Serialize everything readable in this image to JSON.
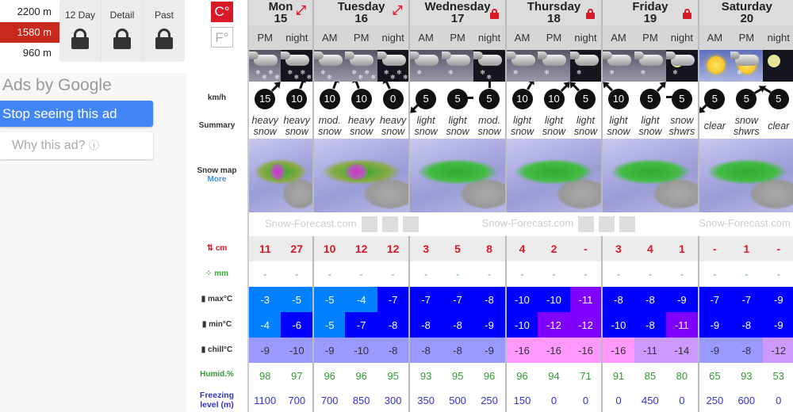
{
  "elevations": [
    {
      "label": "2200 m",
      "selected": false
    },
    {
      "label": "1580 m",
      "selected": true
    },
    {
      "label": "960 m",
      "selected": false
    }
  ],
  "tabs": [
    {
      "label": "12 Day",
      "icon": "lock-icon"
    },
    {
      "label": "Detail",
      "icon": "lock-icon"
    },
    {
      "label": "Past",
      "icon": "lock-icon"
    }
  ],
  "ads": {
    "title": "Ads by Google",
    "stop": "Stop seeing this ad",
    "why": "Why this ad?",
    "why_icon": "ⓘ"
  },
  "units": {
    "c": "C°",
    "f": "F°",
    "selected": "C°"
  },
  "row_labels": {
    "wind": "km/h",
    "summary": "Summary",
    "snowmap": "Snow map",
    "more": "More",
    "snow": "cm",
    "rain": "mm",
    "max": "max°C",
    "min": "min°C",
    "chill": "chill°C",
    "humid": "Humid.%",
    "freezing": "Freezing level (m)"
  },
  "colors": {
    "accent": "#d9192a",
    "temp_light_blue": "#0080ff",
    "temp_blue": "#0000ff",
    "temp_purple": "#8000ff",
    "chill_lavender": "#9999ff",
    "chill_light_purple": "#cc99ff",
    "chill_pink": "#ff99ff"
  },
  "logo_text": "Snow-Forecast.com",
  "days": [
    {
      "name": "Mon",
      "date": "15",
      "badge": "expand-icon",
      "periods": [
        "PM",
        "night"
      ]
    },
    {
      "name": "Tuesday",
      "date": "16",
      "badge": "expand-icon",
      "periods": [
        "AM",
        "PM",
        "night"
      ]
    },
    {
      "name": "Wednesday",
      "date": "17",
      "badge": "lock-icon",
      "periods": [
        "AM",
        "PM",
        "night"
      ]
    },
    {
      "name": "Thursday",
      "date": "18",
      "badge": "lock-icon",
      "periods": [
        "AM",
        "PM",
        "night"
      ]
    },
    {
      "name": "Friday",
      "date": "19",
      "badge": "lock-icon",
      "periods": [
        "AM",
        "PM",
        "night"
      ]
    },
    {
      "name": "Saturday",
      "date": "20",
      "badge": "",
      "periods": [
        "AM",
        "PM",
        "night"
      ]
    }
  ],
  "columns": [
    {
      "icon": "heavy-snow-day",
      "wind": "15",
      "wind_dir": 45,
      "summary": "heavy snow",
      "snow": "11",
      "rain": "-",
      "max": "-3",
      "min": "-4",
      "chill": "-9",
      "humid": "98",
      "freezing": "1100"
    },
    {
      "icon": "heavy-snow-night",
      "wind": "10",
      "wind_dir": 20,
      "summary": "heavy snow",
      "snow": "27",
      "rain": "-",
      "max": "-5",
      "min": "-6",
      "chill": "-10",
      "humid": "97",
      "freezing": "700"
    },
    {
      "icon": "snow-day",
      "wind": "10",
      "wind_dir": 20,
      "summary": "mod. snow",
      "snow": "10",
      "rain": "-",
      "max": "-5",
      "min": "-5",
      "chill": "-9",
      "humid": "96",
      "freezing": "700"
    },
    {
      "icon": "heavy-snow-day",
      "wind": "10",
      "wind_dir": -20,
      "summary": "heavy snow",
      "snow": "12",
      "rain": "-",
      "max": "-4",
      "min": "-7",
      "chill": "-10",
      "humid": "96",
      "freezing": "850"
    },
    {
      "icon": "heavy-snow-night",
      "wind": "0",
      "wind_dir": -25,
      "summary": "heavy snow",
      "snow": "12",
      "rain": "-",
      "max": "-7",
      "min": "-8",
      "chill": "-8",
      "humid": "95",
      "freezing": "300"
    },
    {
      "icon": "light-snow-day",
      "wind": "5",
      "wind_dir": 225,
      "summary": "light snow",
      "snow": "3",
      "rain": "-",
      "max": "-7",
      "min": "-8",
      "chill": "-8",
      "humid": "93",
      "freezing": "350"
    },
    {
      "icon": "light-snow-day",
      "wind": "5",
      "wind_dir": 90,
      "summary": "light snow",
      "snow": "5",
      "rain": "-",
      "max": "-7",
      "min": "-8",
      "chill": "-8",
      "humid": "95",
      "freezing": "500"
    },
    {
      "icon": "snow-night",
      "wind": "5",
      "wind_dir": 0,
      "summary": "mod. snow",
      "snow": "8",
      "rain": "-",
      "max": "-8",
      "min": "-9",
      "chill": "-9",
      "humid": "96",
      "freezing": "250"
    },
    {
      "icon": "light-snow-day",
      "wind": "10",
      "wind_dir": 30,
      "summary": "light snow",
      "snow": "4",
      "rain": "-",
      "max": "-10",
      "min": "-10",
      "chill": "-16",
      "humid": "96",
      "freezing": "150"
    },
    {
      "icon": "light-snow-day",
      "wind": "10",
      "wind_dir": 45,
      "summary": "light snow",
      "snow": "2",
      "rain": "-",
      "max": "-10",
      "min": "-12",
      "chill": "-16",
      "humid": "94",
      "freezing": "0"
    },
    {
      "icon": "light-snow-night",
      "wind": "5",
      "wind_dir": -45,
      "summary": "light snow",
      "snow": "-",
      "rain": "-",
      "max": "-11",
      "min": "-12",
      "chill": "-16",
      "humid": "71",
      "freezing": "0"
    },
    {
      "icon": "light-snow-day",
      "wind": "10",
      "wind_dir": -45,
      "summary": "light snow",
      "snow": "3",
      "rain": "-",
      "max": "-8",
      "min": "-10",
      "chill": "-16",
      "humid": "91",
      "freezing": "0"
    },
    {
      "icon": "light-snow-day",
      "wind": "5",
      "wind_dir": 45,
      "summary": "light snow",
      "snow": "4",
      "rain": "-",
      "max": "-8",
      "min": "-8",
      "chill": "-11",
      "humid": "85",
      "freezing": "450"
    },
    {
      "icon": "moon-cloud-snow",
      "wind": "5",
      "wind_dir": 270,
      "summary": "snow shwrs",
      "snow": "1",
      "rain": "-",
      "max": "-9",
      "min": "-11",
      "chill": "-14",
      "humid": "80",
      "freezing": "0"
    },
    {
      "icon": "clear-day",
      "wind": "5",
      "wind_dir": 225,
      "summary": "clear",
      "snow": "-",
      "rain": "-",
      "max": "-7",
      "min": "-9",
      "chill": "-9",
      "humid": "65",
      "freezing": "250"
    },
    {
      "icon": "sun-cloud-snow",
      "wind": "5",
      "wind_dir": 60,
      "summary": "snow shwrs",
      "snow": "1",
      "rain": "-",
      "max": "-7",
      "min": "-8",
      "chill": "-8",
      "humid": "93",
      "freezing": "600"
    },
    {
      "icon": "clear-night",
      "wind": "5",
      "wind_dir": -60,
      "summary": "clear",
      "snow": "-",
      "rain": "-",
      "max": "-9",
      "min": "-9",
      "chill": "-12",
      "humid": "53",
      "freezing": "0"
    }
  ]
}
